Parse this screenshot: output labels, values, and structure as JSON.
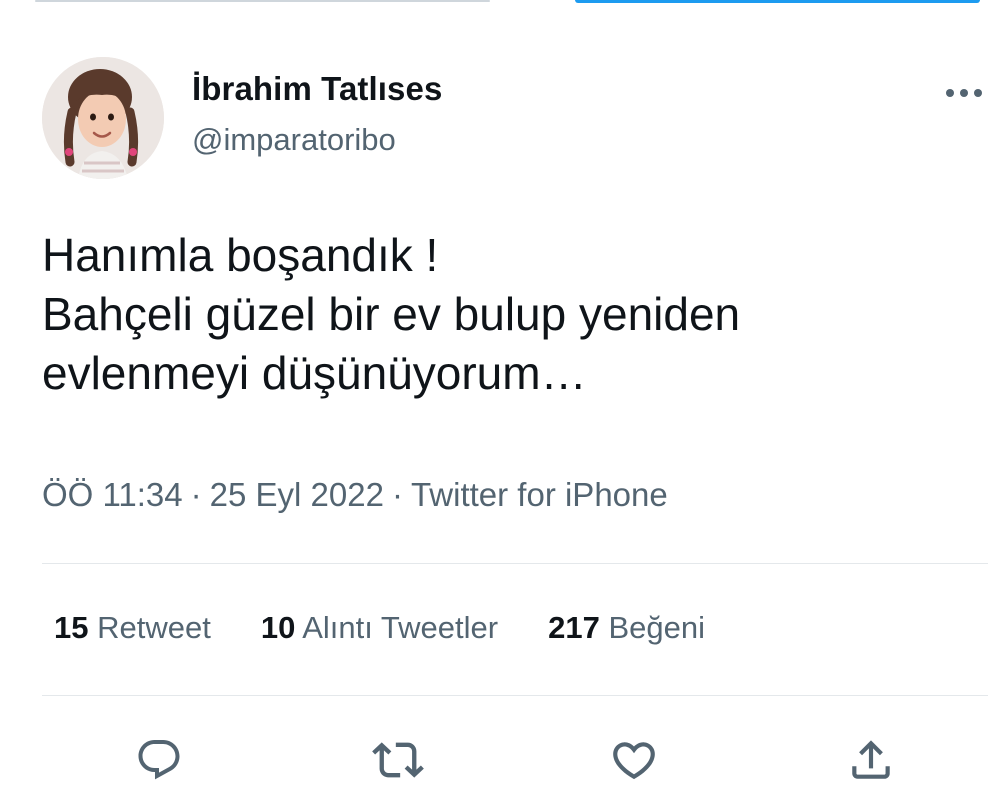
{
  "tweet": {
    "author": {
      "display_name": "İbrahim Tatlıses",
      "handle": "@imparatoribo"
    },
    "text_lines": [
      "Hanımla boşandık !",
      "Bahçeli güzel bir ev bulup yeniden",
      "evlenmeyi düşünüyorum…"
    ],
    "time": "ÖÖ 11:34",
    "date": "25 Eyl 2022",
    "source": "Twitter for iPhone",
    "separator": "·"
  },
  "stats": {
    "retweets": {
      "count": "15",
      "label": "Retweet"
    },
    "quotes": {
      "count": "10",
      "label": "Alıntı Tweetler"
    },
    "likes": {
      "count": "217",
      "label": "Beğeni"
    }
  },
  "icons": {
    "more": "more-horizontal-icon",
    "reply": "reply-icon",
    "retweet": "retweet-icon",
    "like": "heart-icon",
    "share": "share-icon"
  },
  "colors": {
    "text_primary": "#0f1419",
    "text_secondary": "#536471",
    "divider": "#e4e8eb",
    "accent": "#1d9bf0"
  }
}
